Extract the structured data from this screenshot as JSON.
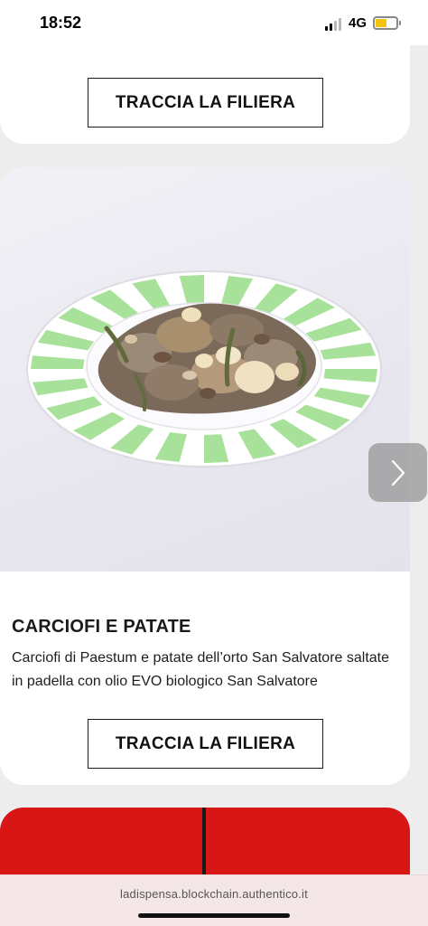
{
  "status_bar": {
    "time": "18:52",
    "network": "4G",
    "battery_level": 0.55,
    "signal_bars": 2,
    "icons": [
      "signal-icon",
      "battery-icon"
    ]
  },
  "cards": [
    {
      "button_label": "TRACCIA LA FILIERA"
    },
    {
      "title": "CARCIOFI E PATATE",
      "description": "Carciofi di Paestum e patate dell’orto San Salvatore saltate in padella con olio EVO biologico San Salvatore",
      "button_label": "TRACCIA LA FILIERA",
      "image_icon": "dish-photo",
      "plate_stripe_color": "#a8e29a"
    }
  ],
  "carousel": {
    "next_icon": "chevron-right-icon"
  },
  "browser": {
    "url": "ladispensa.blockchain.authentico.it"
  },
  "colors": {
    "next_card": "#d81616",
    "url_bar": "#f5e7e8"
  }
}
